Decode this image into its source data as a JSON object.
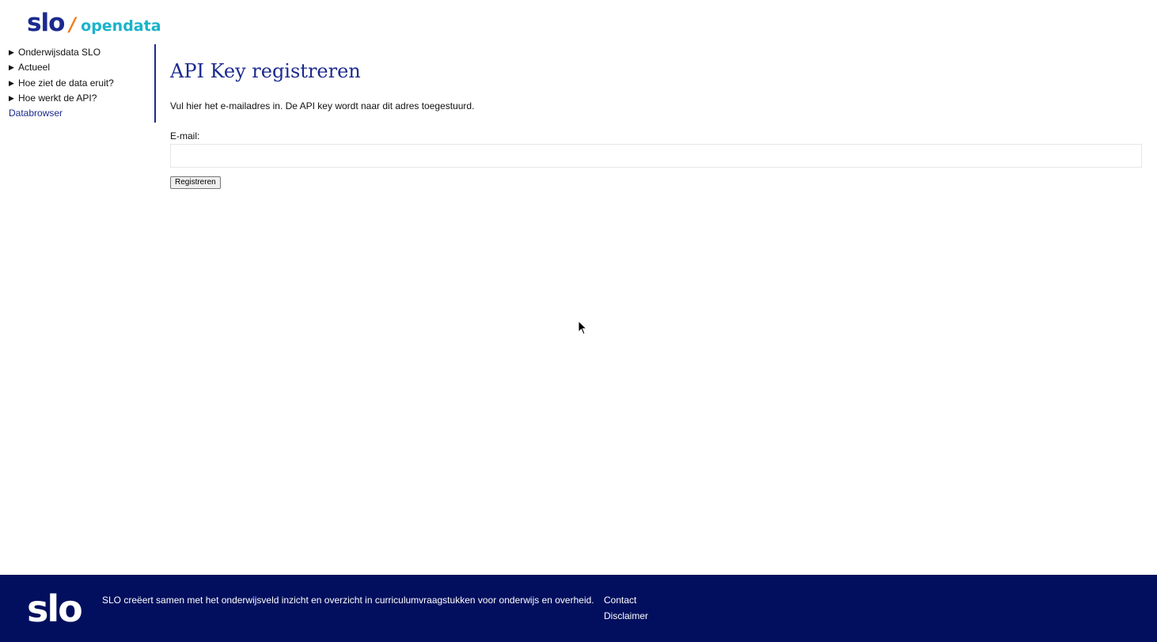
{
  "logo": {
    "brand": "slo",
    "separator": "/",
    "product": "opendata"
  },
  "sidebar": {
    "items": [
      {
        "label": "Onderwijsdata SLO",
        "expandable": true
      },
      {
        "label": "Actueel",
        "expandable": true
      },
      {
        "label": "Hoe ziet de data eruit?",
        "expandable": true
      },
      {
        "label": "Hoe werkt de API?",
        "expandable": true
      },
      {
        "label": "Databrowser",
        "expandable": false
      }
    ]
  },
  "main": {
    "title": "API Key registreren",
    "intro": "Vul hier het e-mailadres in. De API key wordt naar dit adres toegestuurd.",
    "email_label": "E-mail:",
    "email_value": "",
    "submit_label": "Registreren"
  },
  "footer": {
    "logo": "slo",
    "text": "SLO creëert samen met het onderwijsveld inzicht en overzicht in curriculumvraagstukken voor onderwijs en overheid.",
    "links": [
      "Contact",
      "Disclaimer"
    ]
  },
  "colors": {
    "brand_blue": "#1b2a8f",
    "accent_orange": "#f07a1c",
    "accent_teal": "#1ab3c9",
    "footer_bg": "#020f5e"
  },
  "icons": {
    "expand": "triangle-right-icon",
    "cursor": "mouse-pointer-icon"
  }
}
